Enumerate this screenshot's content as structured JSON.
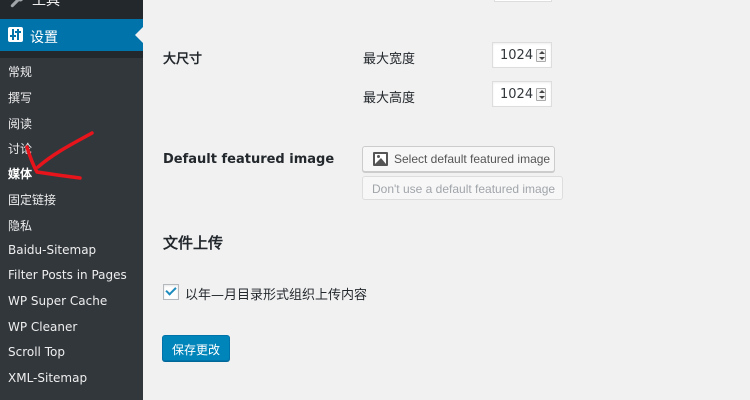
{
  "sidebar": {
    "tools_label": "工具",
    "settings_label": "设置",
    "submenu": [
      {
        "label": "常规"
      },
      {
        "label": "撰写"
      },
      {
        "label": "阅读"
      },
      {
        "label": "讨论"
      },
      {
        "label": "媒体",
        "current": true
      },
      {
        "label": "固定链接"
      },
      {
        "label": "隐私"
      },
      {
        "label": "Baidu-Sitemap"
      },
      {
        "label": "Filter Posts in Pages"
      },
      {
        "label": "WP Super Cache"
      },
      {
        "label": "WP Cleaner"
      },
      {
        "label": "Scroll Top"
      },
      {
        "label": "XML-Sitemap"
      }
    ]
  },
  "main": {
    "large_size": {
      "label": "大尺寸",
      "max_width_label": "最大宽度",
      "max_width_value": "1024",
      "max_height_label": "最大高度",
      "max_height_value": "1024"
    },
    "featured_image": {
      "label": "Default featured image",
      "select_button": "Select default featured image",
      "dont_use_button": "Don't use a default featured image"
    },
    "uploads": {
      "heading": "文件上传",
      "organize_label": "以年—月目录形式组织上传内容",
      "organize_checked": true
    },
    "save_button": "保存更改"
  },
  "colors": {
    "sidebar_bg": "#23282d",
    "submenu_bg": "#32373c",
    "accent": "#0073aa",
    "primary_button": "#0085ba",
    "annotation": "#e8141b"
  }
}
